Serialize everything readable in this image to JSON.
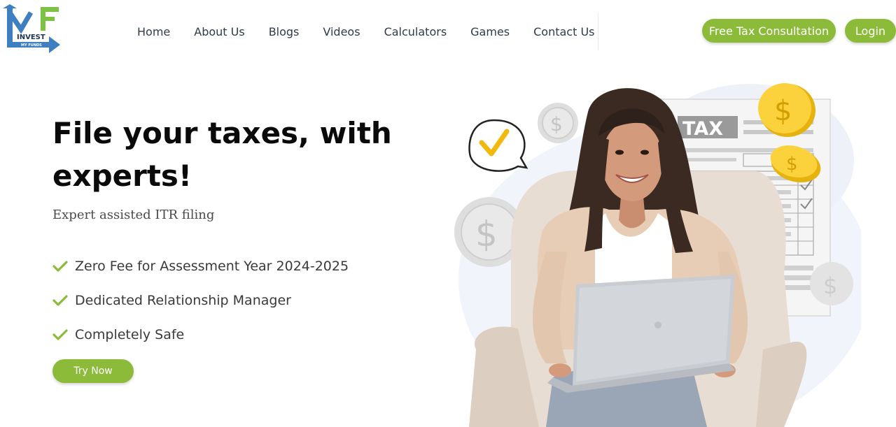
{
  "header": {
    "logo": {
      "letters": "MF",
      "text": "INVEST",
      "subtext": "MY FUNDS"
    },
    "nav": [
      "Home",
      "About Us",
      "Blogs",
      "Videos",
      "Calculators",
      "Games",
      "Contact Us"
    ],
    "consult_label": "Free Tax Consultation",
    "login_label": "Login"
  },
  "hero": {
    "title": "File your taxes, with experts!",
    "subtitle": "Expert assisted ITR filing",
    "features": [
      "Zero Fee for Assessment Year 2024-2025",
      "Dedicated Relationship Manager",
      "Completely Safe"
    ],
    "cta_label": "Try Now"
  },
  "illustration": {
    "form_label": "TAX",
    "coin_symbol": "$"
  },
  "colors": {
    "brand_green": "#8cbb3a",
    "brand_blue": "#3e7fc1",
    "logo_green": "#7cc243"
  },
  "icons": [
    "check-icon",
    "speech-bubble-check-icon",
    "dollar-coin-icon"
  ]
}
